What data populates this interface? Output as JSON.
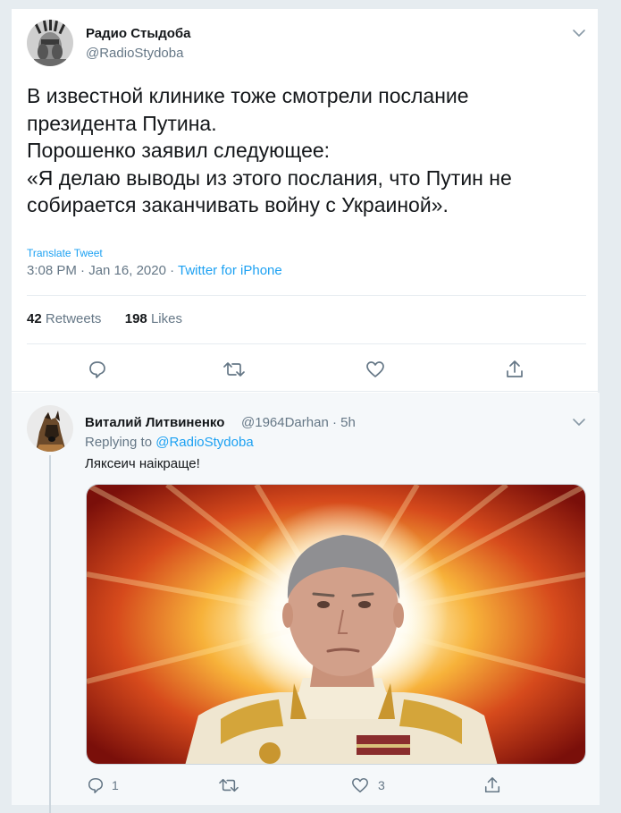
{
  "main_tweet": {
    "author_name": "Радио Стыдоба",
    "author_handle": "@RadioStydoba",
    "text": "В известной клинике тоже смотрели послание\nпрезидента Путина.\nПорошенко заявил следующее:\n«Я делаю выводы из этого послания, что Путин не\nсобирается заканчивать войну с Украиной».",
    "translate_label": "Translate Tweet",
    "timestamp": "3:08 PM · Jan 16, 2020 · ",
    "source": "Twitter for iPhone",
    "retweets_count": "42",
    "retweets_label": "Retweets",
    "likes_count": "198",
    "likes_label": "Likes"
  },
  "reply_tweet": {
    "author_name": "Виталий Литвиненко",
    "author_handle_time": "@1964Darhan · 5h",
    "replying_prefix": "Replying to ",
    "replying_to": "@RadioStydoba",
    "text": "Ляксеич наікраще!",
    "reply_count": "1",
    "like_count": "3"
  },
  "colors": {
    "accent": "#1da1f2",
    "muted": "#657786",
    "border": "#e6ecf0",
    "reply_bg": "#f5f8fa"
  },
  "icons": [
    "chevron-down-icon",
    "reply-icon",
    "retweet-icon",
    "like-icon",
    "share-icon"
  ]
}
